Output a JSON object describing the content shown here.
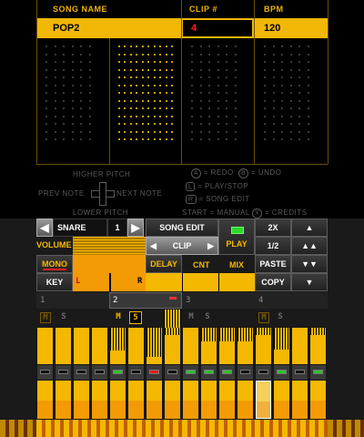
{
  "top": {
    "headers": {
      "song_name": "SONG NAME",
      "clip": "CLIP #",
      "bpm": "BPM"
    },
    "song_name": "POP2",
    "clip_number": "4",
    "bpm": "120",
    "help": {
      "higher_pitch": "HIGHER PITCH",
      "lower_pitch": "LOWER PITCH",
      "prev_note": "PREV NOTE",
      "next_note": "NEXT NOTE",
      "redo_key": "A",
      "redo": "= REDO",
      "undo_key": "B",
      "undo": "= UNDO",
      "play_key": "L",
      "play": "= PLAY/STOP",
      "edit_key": "R",
      "edit": "= SONG EDIT",
      "start": "START = MANUAL",
      "credits_key": "X",
      "credits": "= CREDITS"
    }
  },
  "bottom": {
    "instrument": "SNARE",
    "instrument_index": "1",
    "song_edit": "SONG EDIT",
    "clip": "CLIP",
    "play": "PLAY",
    "speed_2x": "2X",
    "speed_half": "1/2",
    "volume": "VOLUME",
    "mono": "MONO",
    "delay": "DELAY",
    "cnt": "CNT",
    "mix": "MIX",
    "paste": "PASTE",
    "key": "KEY",
    "left_ch": "L",
    "right_ch": "R",
    "copy": "COPY",
    "tabs": [
      "1",
      "2",
      "3",
      "4"
    ],
    "mute_labels": [
      "M",
      "S",
      "M",
      "S",
      "M",
      "S",
      "M",
      "S"
    ],
    "active_solo": "5",
    "led_states": [
      0,
      0,
      0,
      0,
      1,
      0,
      2,
      0,
      1,
      1,
      1,
      0,
      0,
      1,
      0,
      1
    ],
    "step_levels": [
      0.0,
      0.0,
      0.0,
      0.0,
      0.62,
      0.0,
      0.8,
      0.2,
      0.0,
      0.38,
      0.38,
      0.38,
      0.2,
      0.6,
      0.0,
      0.2
    ]
  }
}
